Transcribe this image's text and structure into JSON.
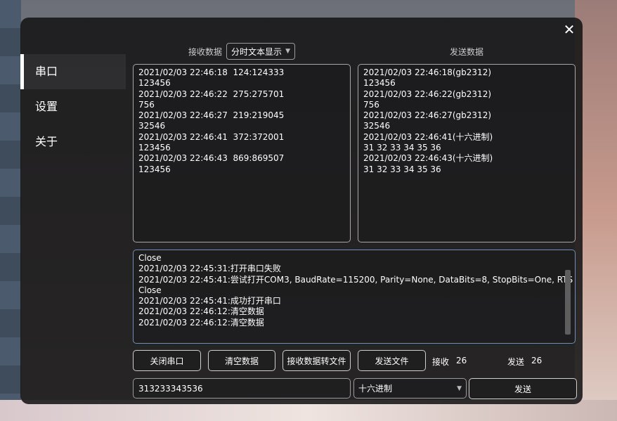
{
  "window": {
    "close_label": "✕"
  },
  "nav": {
    "items": [
      {
        "label": "串口"
      },
      {
        "label": "设置"
      },
      {
        "label": "关于"
      }
    ]
  },
  "receive": {
    "label": "接收数据",
    "mode_selected": "分时文本显示",
    "lines": [
      "2021/02/03 22:46:18  124:124333",
      "123456",
      "2021/02/03 22:46:22  275:275701",
      "756",
      "2021/02/03 22:46:27  219:219045",
      "32546",
      "2021/02/03 22:46:41  372:372001",
      "123456",
      "2021/02/03 22:46:43  869:869507",
      "123456"
    ]
  },
  "send_panel": {
    "label": "发送数据",
    "lines": [
      "2021/02/03 22:46:18(gb2312)",
      "123456",
      "2021/02/03 22:46:22(gb2312)",
      "756",
      "2021/02/03 22:46:27(gb2312)",
      "32546",
      "2021/02/03 22:46:41(十六进制)",
      "31 32 33 34 35 36",
      "2021/02/03 22:46:43(十六进制)",
      "31 32 33 34 35 36"
    ]
  },
  "log": {
    "lines": [
      "Close",
      "2021/02/03 22:45:31:打开串口失败",
      "2021/02/03 22:45:41:尝试打开COM3, BaudRate=115200, Parity=None, DataBits=8, StopBits=One, RTS",
      "Close",
      "2021/02/03 22:45:41:成功打开串口",
      "2021/02/03 22:46:12:清空数据",
      "2021/02/03 22:46:12:清空数据"
    ]
  },
  "buttons": {
    "close_port": "关闭串口",
    "clear_data": "清空数据",
    "recv_to_file": "接收数据转文件",
    "send_file": "发送文件",
    "send": "发送"
  },
  "counters": {
    "recv_label": "接收",
    "recv_value": "26",
    "send_label": "发送",
    "send_value": "26"
  },
  "send_input": {
    "value": "313233343536",
    "encoding_selected": "十六进制"
  }
}
